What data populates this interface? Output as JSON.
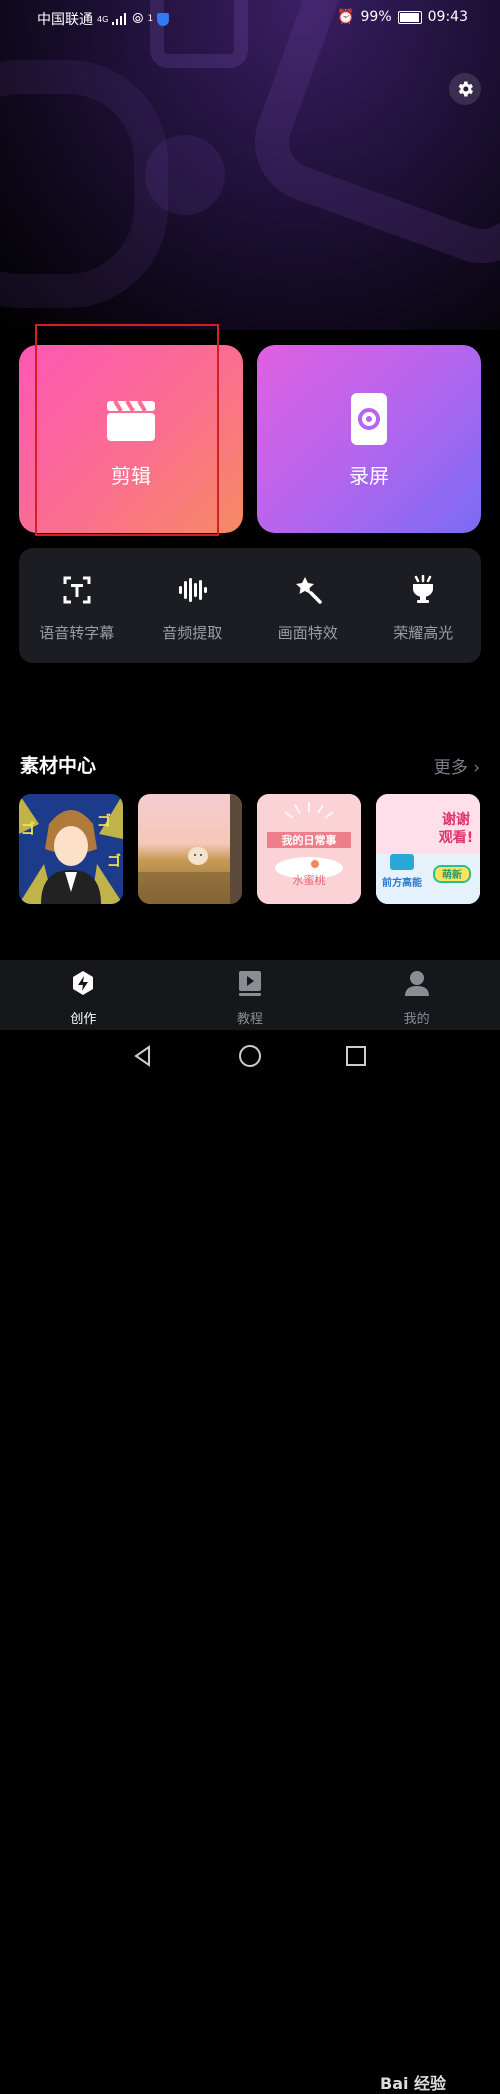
{
  "status_bar": {
    "carrier": "中国联通",
    "network": "4G",
    "hotspot_badge": "1",
    "battery": "99%",
    "time": "09:43"
  },
  "header": {
    "settings_icon": "gear-icon"
  },
  "main_cards": [
    {
      "label": "剪辑",
      "icon": "clapperboard-icon"
    },
    {
      "label": "录屏",
      "icon": "screen-record-icon"
    }
  ],
  "tools": [
    {
      "label": "语音转字幕",
      "icon": "text-recognize-icon"
    },
    {
      "label": "音频提取",
      "icon": "audio-wave-icon"
    },
    {
      "label": "画面特效",
      "icon": "magic-wand-icon"
    },
    {
      "label": "荣耀高光",
      "icon": "trophy-icon"
    }
  ],
  "materials": {
    "title": "素材中心",
    "more": "更多",
    "items": [
      {
        "text_lines": [
          "ゴ",
          "ゴ",
          "ゴ"
        ]
      },
      {
        "text_lines": []
      },
      {
        "text_lines": [
          "我的日常事",
          "水蜜桃"
        ]
      },
      {
        "text_lines": [
          "谢谢",
          "观看!",
          "前方高能",
          "萌新"
        ]
      }
    ]
  },
  "tabbar": {
    "tabs": [
      {
        "label": "创作",
        "icon": "lightning-icon",
        "active": true
      },
      {
        "label": "教程",
        "icon": "video-book-icon",
        "active": false
      },
      {
        "label": "我的",
        "icon": "user-icon",
        "active": false
      }
    ]
  },
  "watermark": "Bai 经验"
}
